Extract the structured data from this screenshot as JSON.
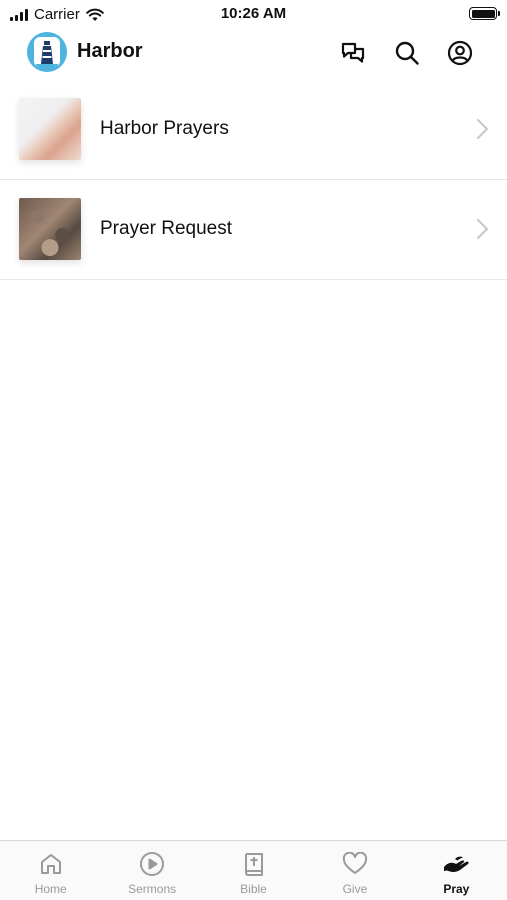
{
  "status_bar": {
    "carrier": "Carrier",
    "time": "10:26 AM"
  },
  "header": {
    "app_name": "Harbor",
    "logo_icon": "lighthouse-logo-icon",
    "actions": [
      {
        "icon": "chat-icon"
      },
      {
        "icon": "search-icon"
      },
      {
        "icon": "account-icon"
      }
    ]
  },
  "list": {
    "items": [
      {
        "label": "Harbor Prayers",
        "thumbnail": "praying-hands-image"
      },
      {
        "label": "Prayer Request",
        "thumbnail": "rock-texture-image"
      }
    ]
  },
  "tab_bar": {
    "tabs": [
      {
        "label": "Home",
        "icon": "home-icon",
        "active": false
      },
      {
        "label": "Sermons",
        "icon": "play-icon",
        "active": false
      },
      {
        "label": "Bible",
        "icon": "bible-icon",
        "active": false
      },
      {
        "label": "Give",
        "icon": "heart-icon",
        "active": false
      },
      {
        "label": "Pray",
        "icon": "pray-hand-icon",
        "active": true
      }
    ]
  },
  "colors": {
    "logo_bg": "#4fb3df",
    "inactive_tab": "#9a9a9a",
    "active_tab": "#111111"
  }
}
